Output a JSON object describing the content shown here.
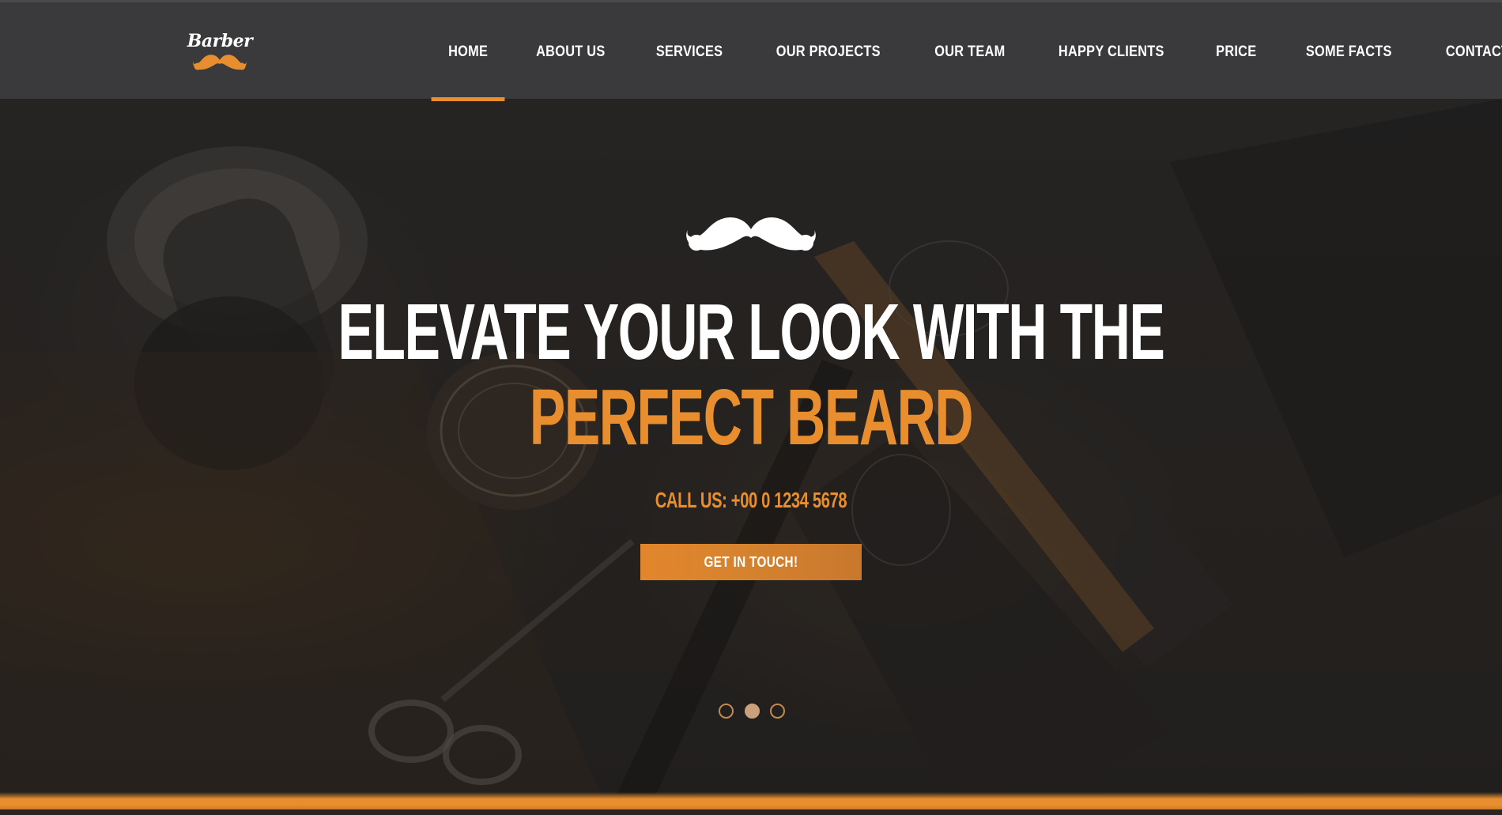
{
  "header": {
    "logo": {
      "text": "Barber",
      "icon": "mustache-icon"
    },
    "nav": [
      {
        "label": "HOME",
        "active": true
      },
      {
        "label": "ABOUT US"
      },
      {
        "label": "SERVICES"
      },
      {
        "label": "OUR PROJECTS"
      },
      {
        "label": "OUR TEAM"
      },
      {
        "label": "HAPPY CLIENTS"
      },
      {
        "label": "PRICE"
      },
      {
        "label": "SOME FACTS"
      },
      {
        "label": "CONTACT US"
      }
    ]
  },
  "hero": {
    "icon": "mustache-icon",
    "headline_line1": "ELEVATE YOUR LOOK WITH THE",
    "headline_line2": "PERFECT BEARD",
    "call_us": "CALL US: +00 0 1234 5678",
    "cta_label": "GET IN TOUCH!",
    "slider": {
      "count": 3,
      "active_index": 1
    }
  },
  "colors": {
    "accent": "#e88e2e",
    "navbar_bg": "#3a3a3c",
    "text_light": "#ffffff"
  }
}
